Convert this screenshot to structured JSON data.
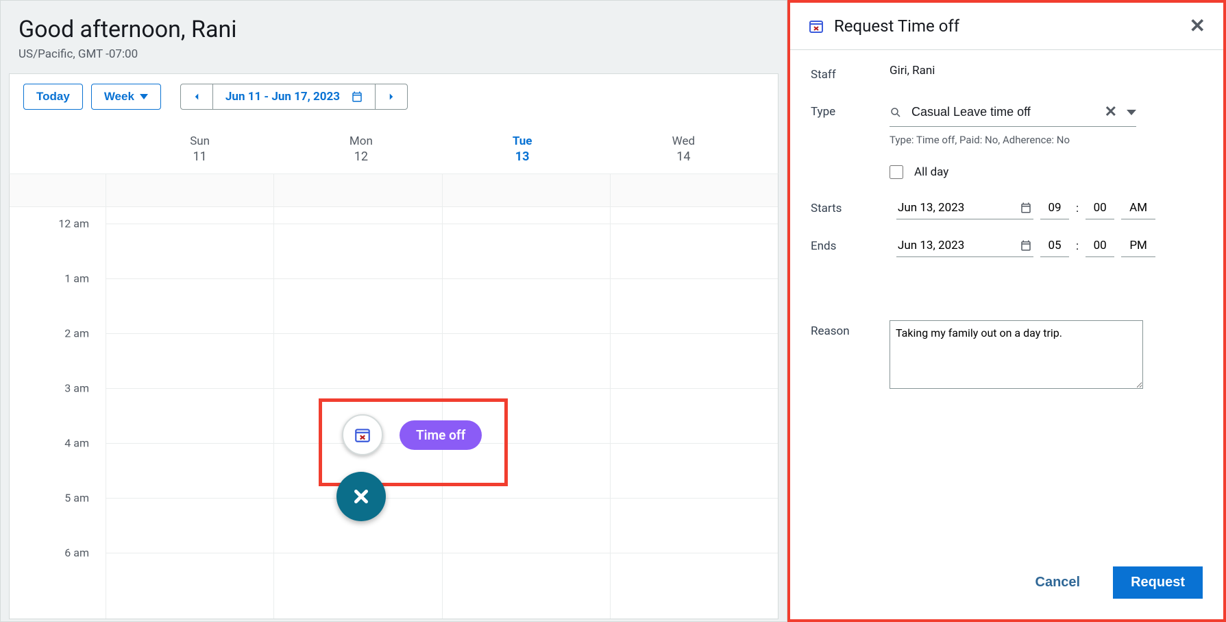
{
  "header": {
    "greeting": "Good afternoon, Rani",
    "timezone": "US/Pacific, GMT -07:00"
  },
  "toolbar": {
    "today_label": "Today",
    "view_label": "Week",
    "date_range": "Jun 11 - Jun 17, 2023"
  },
  "days": [
    {
      "dow": "Sun",
      "num": "11",
      "today": false
    },
    {
      "dow": "Mon",
      "num": "12",
      "today": false
    },
    {
      "dow": "Tue",
      "num": "13",
      "today": true
    },
    {
      "dow": "Wed",
      "num": "14",
      "today": false
    }
  ],
  "time_labels": [
    "12 am",
    "1 am",
    "2 am",
    "3 am",
    "4 am",
    "5 am",
    "6 am"
  ],
  "fab": {
    "timeoff_label": "Time off"
  },
  "panel": {
    "title": "Request Time off",
    "staff_label": "Staff",
    "staff_value": "Giri, Rani",
    "type_label": "Type",
    "type_value": "Casual Leave time off",
    "type_meta": "Type: Time off, Paid: No, Adherence: No",
    "allday_label": "All day",
    "starts_label": "Starts",
    "ends_label": "Ends",
    "starts": {
      "date": "Jun 13, 2023",
      "hh": "09",
      "mm": "00",
      "ampm": "AM"
    },
    "ends": {
      "date": "Jun 13, 2023",
      "hh": "05",
      "mm": "00",
      "ampm": "PM"
    },
    "reason_label": "Reason",
    "reason_value": "Taking my family out on a day trip.",
    "cancel_label": "Cancel",
    "request_label": "Request"
  }
}
